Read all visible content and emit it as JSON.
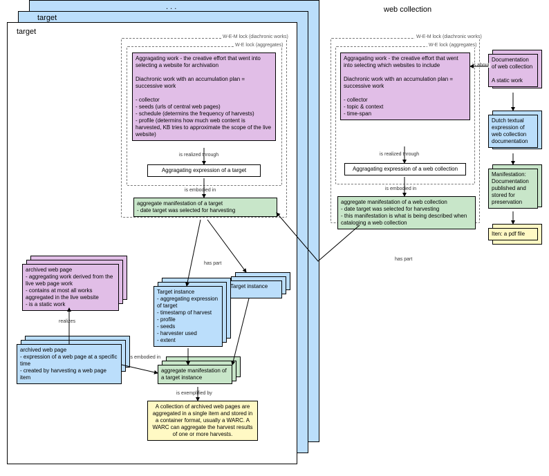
{
  "titles": {
    "target_outer": "target",
    "target_inner": "target",
    "web_collection": "web collection",
    "dots": ". . ."
  },
  "dashed": {
    "wem": "W-E-M lock (diachronic works)",
    "we": "W-E lock (aggregates)",
    "wem2": "W-E-M lock (diachronic works)",
    "we2": "W-E lock (aggregates)"
  },
  "target": {
    "agg_work": "Aggragating work - the creative effort that went into selecting a website for archivation\n\nDiachronic work with an accumulation plan = successive work\n\n- collector\n- seeds (urls of central web pages)\n- schedule (determins the frequency of harvests)\n- profile (determins how much web content is harvested, KB tries to approximate the scope of the live website)",
    "agg_expr": "Aggragating expression of a target",
    "agg_man": "aggregate manifestation of a target\n- date target was selected for harvesting"
  },
  "web_collection": {
    "agg_work": "Aggragating work - the creative effort that went into selecting which websites to include\n\nDiachronic work with an accumulation plan = successive work\n\n- collector\n- topic & context\n- time-span",
    "agg_expr": "Aggragating expression of a web collection",
    "agg_man": "aggregate manifestation of a web collection\n- date target was selected for harvesting\n- this manifestation is what is being described when cataloging a web collection"
  },
  "archived": {
    "work": "archived web page\n- aggregating work derived from the live web page work\n- contains at most all works aggregated in the live website\n- is a static work",
    "expr": "archived web page\n- expression of a web page at a specific time\n- created by harvesting a web page item",
    "t_instance": "Target instance\n- aggregating expression of target\n- timestamp of harvest\n- profile\n- seeds\n- harvester used\n- extent",
    "t_instance_label": "Target instance",
    "t_instance_man": "aggregate manifestation of a target instance",
    "warc": "A collection of archived web pages are aggregated in a single item and stored in a container format, usually a WARC. A WARC can aggregate the harvest results of one or more harvests."
  },
  "docs": {
    "doc_work": "Documentation of web collection\n\nA static work",
    "doc_expr": "Dutch textual expression of web collection documentation",
    "doc_man": "Manifestation: Documentation published and stored for preservation",
    "doc_item": "Iten: a pdf file"
  },
  "edges": {
    "realized": "is realized through",
    "embodied": "is embodied in",
    "has_part": "has part",
    "realizes": "realizes",
    "exemplified": "is exemplified by",
    "is_about": "is about"
  },
  "icons": {
    "arrow": "▶"
  }
}
